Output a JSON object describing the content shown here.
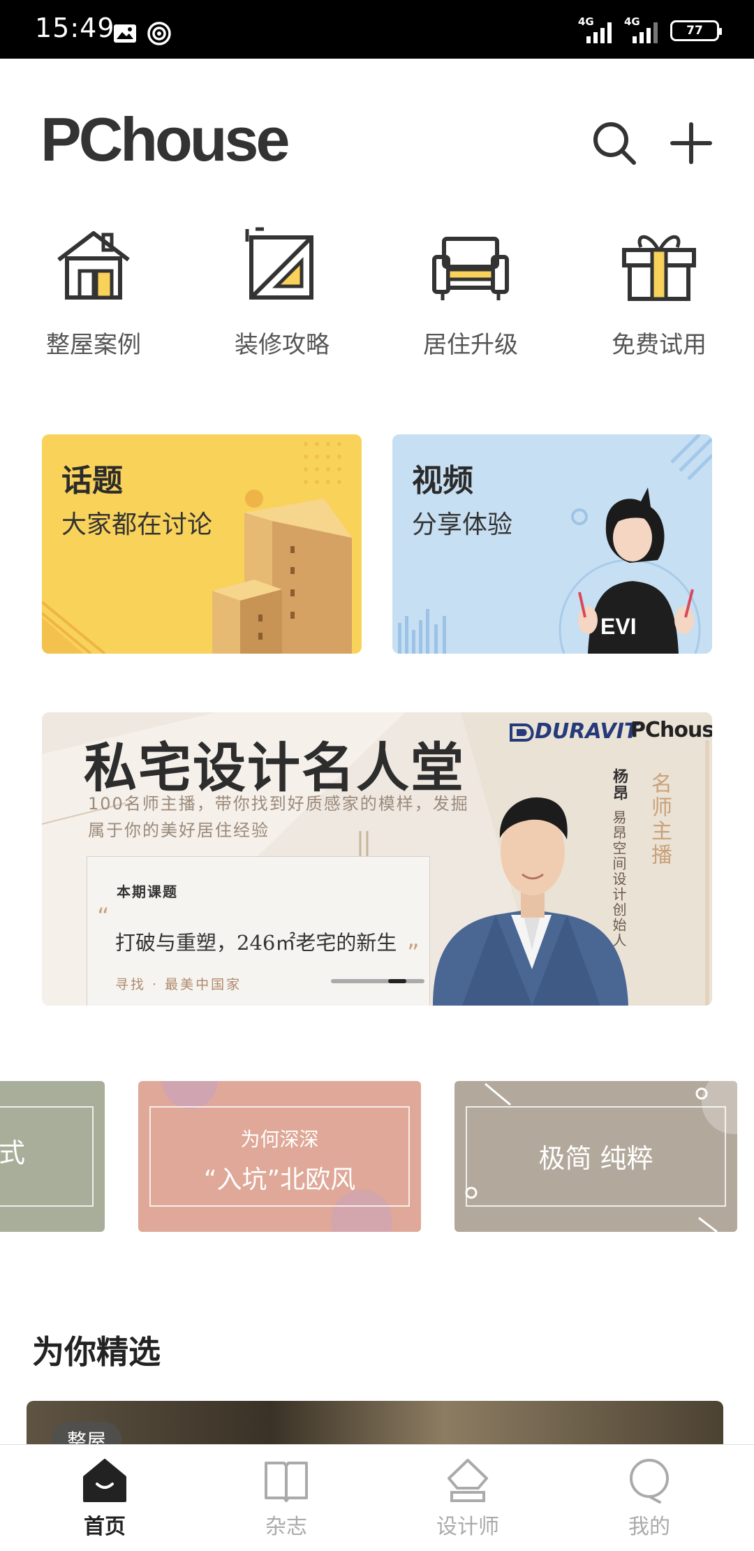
{
  "status_bar": {
    "time": "15:49",
    "network1": "4G",
    "network2": "4G",
    "battery": "77"
  },
  "header": {
    "logo": "PChouse",
    "search_icon": "search-icon",
    "add_icon": "plus-icon"
  },
  "categories": [
    {
      "label": "整屋案例",
      "icon": "house-icon"
    },
    {
      "label": "装修攻略",
      "icon": "ruler-triangle-icon"
    },
    {
      "label": "居住升级",
      "icon": "sofa-icon"
    },
    {
      "label": "免费试用",
      "icon": "gift-icon"
    }
  ],
  "cards": {
    "topic": {
      "title": "话题",
      "subtitle": "大家都在讨论"
    },
    "video": {
      "title": "视频",
      "subtitle": "分享体验"
    }
  },
  "banner": {
    "title": "私宅设计名人堂",
    "subtitle": "100名师主播，带你找到好质感家的模样，发掘属于你的美好居住经验",
    "topic_label": "本期课题",
    "topic": "打破与重塑，246㎡老宅的新生",
    "find": "寻找 · 最美中国家",
    "brand1": "DURAVIT",
    "brand2": "PChouse",
    "host_name": "杨昂",
    "host_title": "易昂空间设计创始人",
    "host_role": "名师主播"
  },
  "styles": [
    {
      "text": "中式"
    },
    {
      "line1": "为何深深",
      "line2": "“入坑”北欧风"
    },
    {
      "text": "极简 纯粹"
    }
  ],
  "section": {
    "title": "为你精选",
    "tag": "整屋"
  },
  "tabs": [
    {
      "label": "首页",
      "icon": "home-icon",
      "active": true
    },
    {
      "label": "杂志",
      "icon": "book-icon",
      "active": false
    },
    {
      "label": "设计师",
      "icon": "designer-icon",
      "active": false
    },
    {
      "label": "我的",
      "icon": "profile-icon",
      "active": false
    }
  ],
  "colors": {
    "accent_yellow": "#f9d25a",
    "video_blue": "#c7dff2",
    "nordic_pink": "#dfa898",
    "minimal_taupe": "#b2a89b",
    "chinese_sage": "#a9ae9a"
  }
}
